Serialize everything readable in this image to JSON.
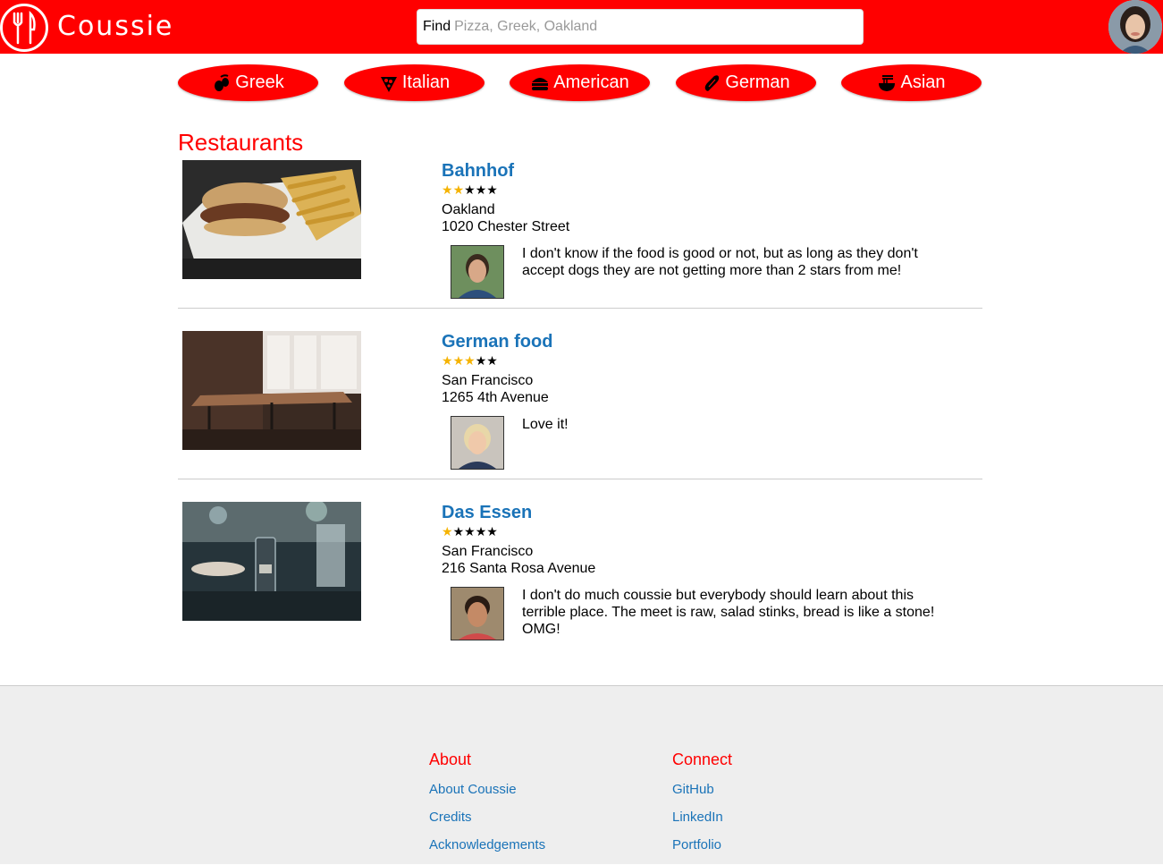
{
  "header": {
    "brand": "Coussie",
    "search_label": "Find",
    "search_placeholder": "Pizza, Greek, Oakland",
    "logo_icon": "fork-knife-icon",
    "accent": "#ff0000"
  },
  "categories": [
    {
      "label": "Greek",
      "icon": "olive-icon"
    },
    {
      "label": "Italian",
      "icon": "pizza-icon"
    },
    {
      "label": "American",
      "icon": "burger-icon"
    },
    {
      "label": "German",
      "icon": "sausage-icon"
    },
    {
      "label": "Asian",
      "icon": "noodle-bowl-icon"
    }
  ],
  "section_title": "Restaurants",
  "restaurants": [
    {
      "name": "Bahnhof",
      "rating": 2,
      "max_rating": 5,
      "city": "Oakland",
      "address": "1020 Chester Street",
      "review": "I don't know if the food is good or not, but as long as they don't accept dogs they are not getting more than 2 stars from me!"
    },
    {
      "name": "German food",
      "rating": 3,
      "max_rating": 5,
      "city": "San Francisco",
      "address": "1265 4th Avenue",
      "review": "Love it!"
    },
    {
      "name": "Das Essen",
      "rating": 1,
      "max_rating": 5,
      "city": "San Francisco",
      "address": "216 Santa Rosa Avenue",
      "review": "I don't do much coussie but everybody should learn about this terrible place. The meet is raw, salad stinks, bread is like a stone! OMG!"
    }
  ],
  "footer": {
    "about": {
      "title": "About",
      "links": [
        "About Coussie",
        "Credits",
        "Acknowledgements"
      ]
    },
    "connect": {
      "title": "Connect",
      "links": [
        "GitHub",
        "LinkedIn",
        "Portfolio"
      ]
    }
  }
}
